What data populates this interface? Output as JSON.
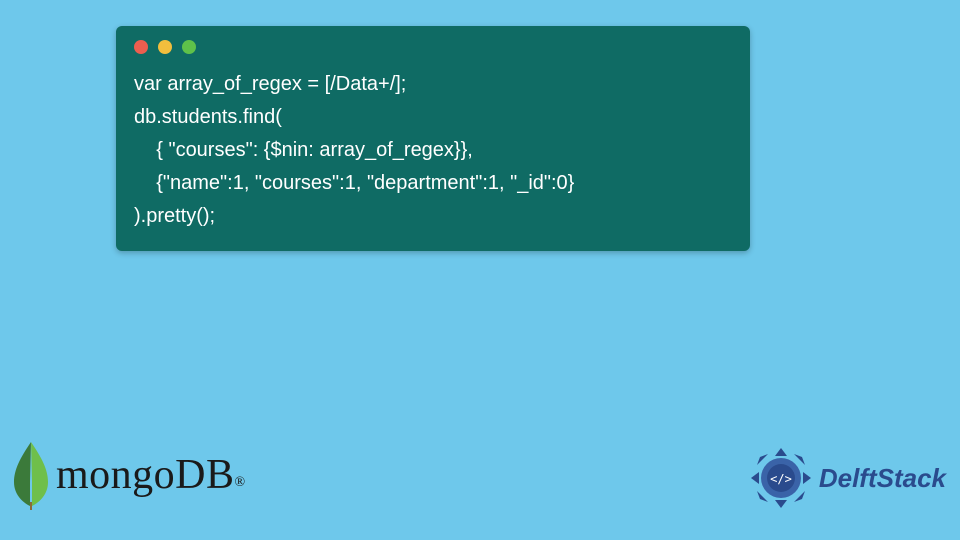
{
  "code": {
    "lines": [
      "var array_of_regex = [/Data+/];",
      "db.students.find(",
      "    { \"courses\": {$nin: array_of_regex}},",
      "    {\"name\":1, \"courses\":1, \"department\":1, \"_id\":0}",
      ").pretty();"
    ]
  },
  "mongo": {
    "text": "mongoDB",
    "reg": "®"
  },
  "delft": {
    "text": "DelftStack"
  },
  "colors": {
    "bg": "#6ec8eb",
    "window": "#0f6b64",
    "leaf_dark": "#3b7a3a",
    "leaf_light": "#6fbf4b",
    "delft_blue": "#2a4b8d"
  }
}
